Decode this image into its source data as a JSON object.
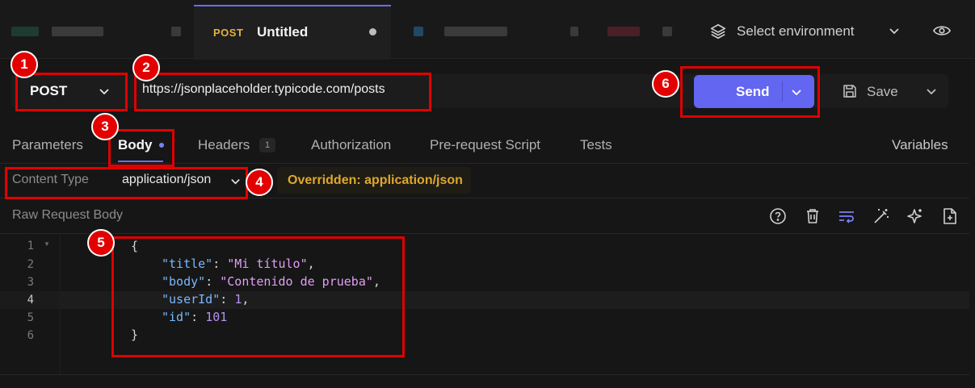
{
  "tabs": {
    "active": {
      "method": "POST",
      "title": "Untitled"
    },
    "environment": {
      "label": "Select environment"
    }
  },
  "request": {
    "method": "POST",
    "url": "https://jsonplaceholder.typicode.com/posts",
    "send_label": "Send",
    "save_label": "Save"
  },
  "subtabs": {
    "parameters": "Parameters",
    "body": "Body",
    "headers": "Headers",
    "headers_count": "1",
    "authorization": "Authorization",
    "prerequest": "Pre-request Script",
    "tests": "Tests",
    "variables": "Variables"
  },
  "content_type": {
    "label": "Content Type",
    "value": "application/json",
    "override": "Overridden: application/json"
  },
  "editor": {
    "label": "Raw Request Body",
    "line_numbers": [
      "1",
      "2",
      "3",
      "4",
      "5",
      "6"
    ],
    "current_line": "4",
    "lines": {
      "l1": "{",
      "l2_key": "\"title\"",
      "l2_colon": ": ",
      "l2_val": "\"Mi título\"",
      "l2_comma": ",",
      "l3_key": "\"body\"",
      "l3_colon": ": ",
      "l3_val": "\"Contenido de prueba\"",
      "l3_comma": ",",
      "l4_key": "\"userId\"",
      "l4_colon": ": ",
      "l4_val": "1",
      "l4_comma": ",",
      "l5_key": "\"id\"",
      "l5_colon": ": ",
      "l5_val": "101",
      "l6": "}"
    },
    "tool_icons": [
      "help-icon",
      "trash-icon",
      "wrap-icon",
      "magic-wand-icon",
      "sparkle-icon",
      "add-file-icon"
    ]
  },
  "annotations": {
    "markers": [
      "1",
      "2",
      "3",
      "4",
      "5",
      "6"
    ]
  },
  "colors": {
    "accent": "#6366f1",
    "annotation": "#e00000",
    "method": "#e3b341",
    "override": "#e0a82e",
    "json_key": "#79b8ff",
    "json_string": "#e19ef5",
    "json_number": "#b392f0"
  }
}
